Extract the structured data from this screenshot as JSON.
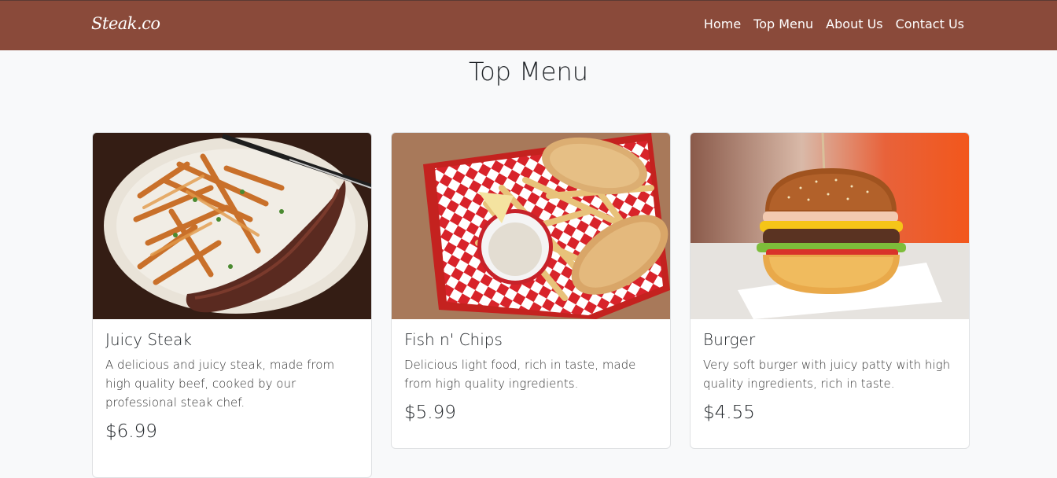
{
  "brand": "Steak.co",
  "nav": [
    "Home",
    "Top Menu",
    "About Us",
    "Contact Us"
  ],
  "page_title": "Top Menu",
  "cards": [
    {
      "title": "Juicy Steak",
      "description": "A delicious and juicy steak, made from high quality beef, cooked by our professional steak chef.",
      "price": "$6.99"
    },
    {
      "title": "Fish n' Chips",
      "description": "Delicious light food, rich in taste, made from high quality ingredients.",
      "price": "$5.99"
    },
    {
      "title": "Burger",
      "description": "Very soft burger with juicy patty with high quality ingredients, rich in taste.",
      "price": "$4.55"
    }
  ],
  "colors": {
    "navbar": "#8a4a3a",
    "background": "#f8f9fa",
    "card_border": "#dfe1e3"
  }
}
